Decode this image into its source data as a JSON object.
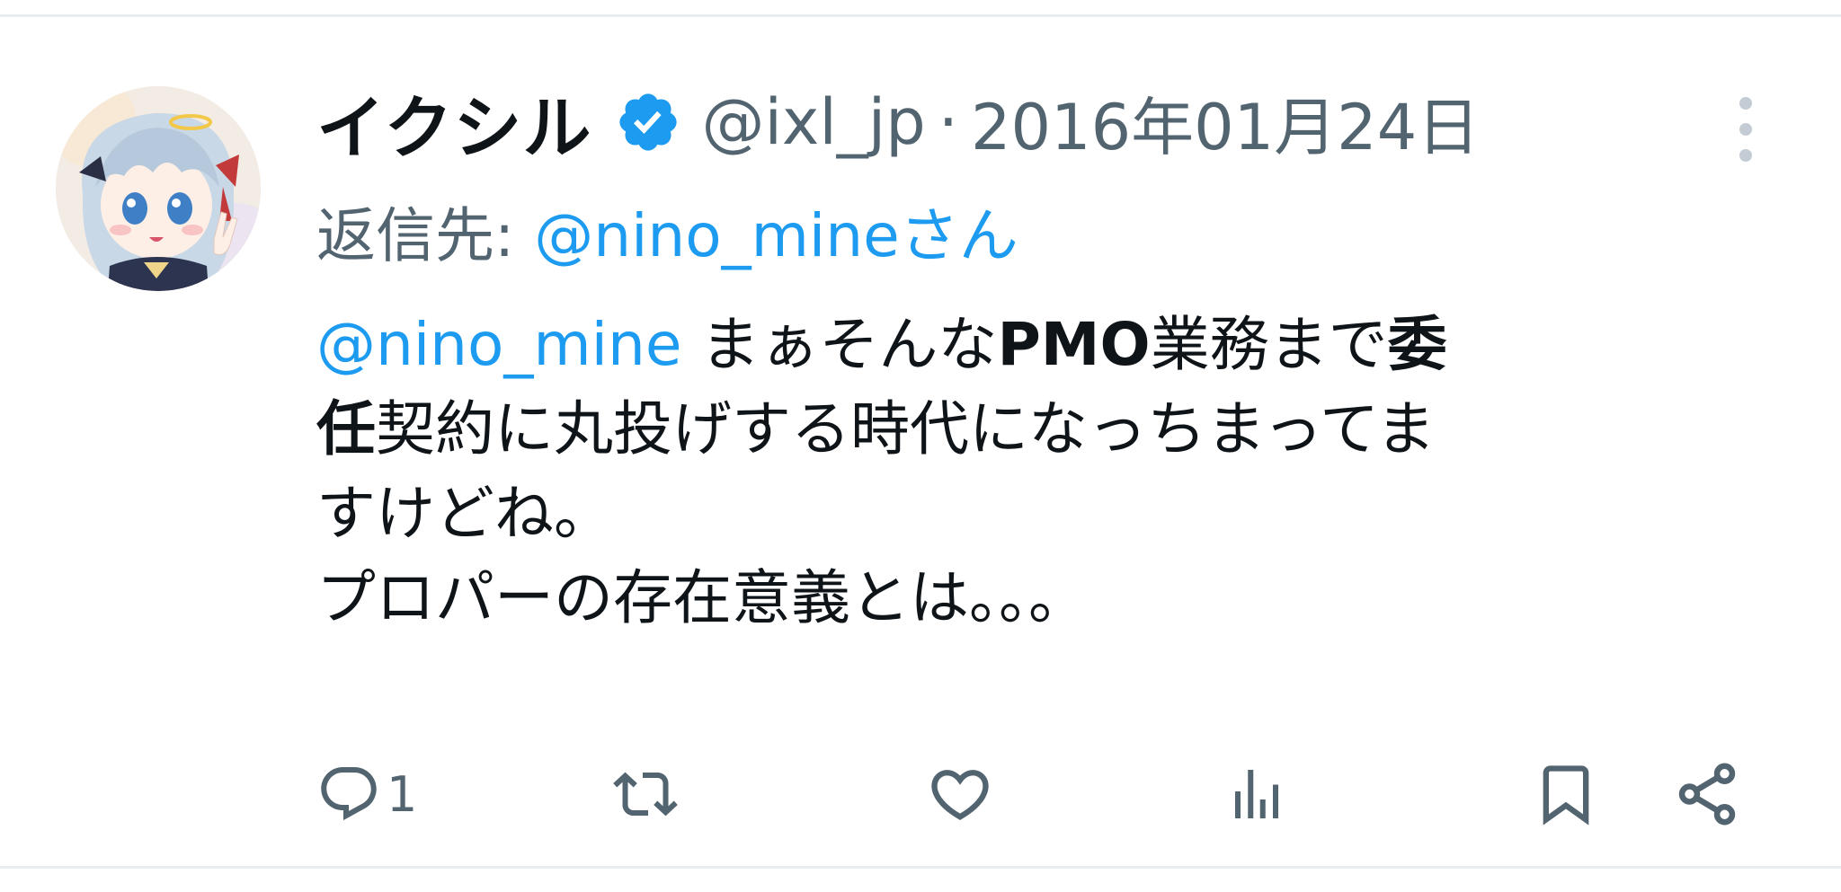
{
  "tweet": {
    "author": {
      "display_name": "イクシル",
      "verified": true,
      "handle": "@ixl_jp",
      "avatar_icon": "avatar-anime-girl"
    },
    "separator": "·",
    "date": "2016年01月24日",
    "reply": {
      "prefix": "返信先:",
      "target": "@nino_mineさん"
    },
    "body": {
      "line1": {
        "mention": "@nino_mine",
        "text_a": " まぁそんな",
        "bold_a": "PMO",
        "text_b": "業務まで",
        "bold_b": "委"
      },
      "line2": {
        "bold_a": "任",
        "text_a": "契約に丸投げする時代になっちまってま"
      },
      "line3": "すけどね。",
      "line4": "プロパーの存在意義とは。。。"
    },
    "actions": {
      "reply_count": "1",
      "reply_icon": "reply-icon",
      "retweet_icon": "retweet-icon",
      "like_icon": "heart-icon",
      "views_icon": "views-chart-icon",
      "bookmark_icon": "bookmark-icon",
      "share_icon": "share-icon"
    },
    "colors": {
      "accent": "#1d9bf0",
      "secondary_text": "#536471",
      "primary_text": "#0f1419"
    }
  }
}
